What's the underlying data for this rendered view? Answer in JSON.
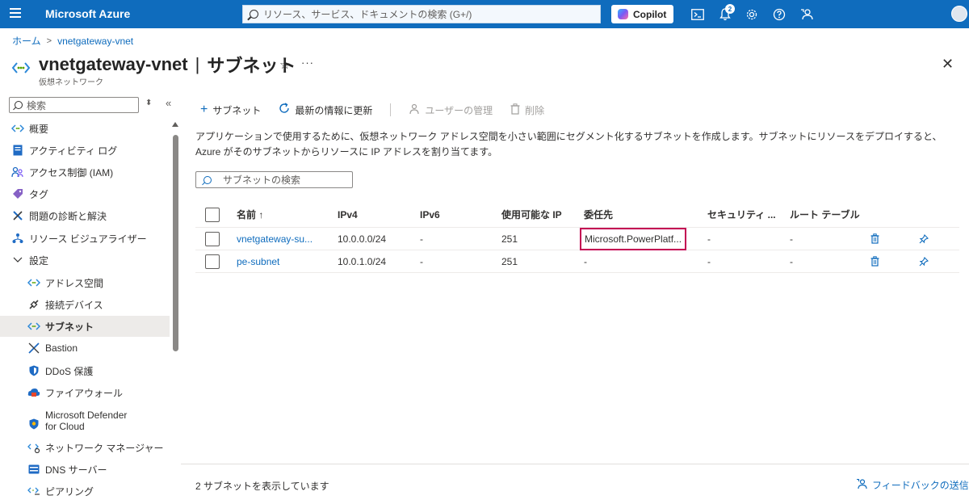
{
  "topbar": {
    "brand": "Microsoft Azure",
    "search_placeholder": "リソース、サービス、ドキュメントの検索 (G+/)",
    "copilot_label": "Copilot",
    "notification_count": "2",
    "accent_color": "#0f6cbd"
  },
  "breadcrumb": {
    "home": "ホーム",
    "current": "vnetgateway-vnet"
  },
  "header": {
    "resource_name": "vnetgateway-vnet",
    "separator": "|",
    "section": "サブネット",
    "subtitle": "仮想ネットワーク"
  },
  "sidebar": {
    "search_placeholder": "検索",
    "items": [
      {
        "label": "概要",
        "icon": "overview-icon"
      },
      {
        "label": "アクティビティ ログ",
        "icon": "activity-log-icon"
      },
      {
        "label": "アクセス制御 (IAM)",
        "icon": "iam-icon"
      },
      {
        "label": "タグ",
        "icon": "tag-icon"
      },
      {
        "label": "問題の診断と解決",
        "icon": "diagnose-icon"
      },
      {
        "label": "リソース ビジュアライザー",
        "icon": "visualizer-icon"
      },
      {
        "label": "設定",
        "icon": "chevron-down-icon"
      },
      {
        "label": "アドレス空間",
        "icon": "address-space-icon"
      },
      {
        "label": "接続デバイス",
        "icon": "connected-devices-icon"
      },
      {
        "label": "サブネット",
        "icon": "subnet-icon"
      },
      {
        "label": "Bastion",
        "icon": "bastion-icon"
      },
      {
        "label": "DDoS 保護",
        "icon": "ddos-icon"
      },
      {
        "label": "ファイアウォール",
        "icon": "firewall-icon"
      },
      {
        "label": "Microsoft Defender for Cloud",
        "line1": "Microsoft Defender",
        "line2": "for Cloud",
        "icon": "defender-icon"
      },
      {
        "label": "ネットワーク マネージャー",
        "icon": "network-manager-icon"
      },
      {
        "label": "DNS サーバー",
        "icon": "dns-icon"
      },
      {
        "label": "ピアリング",
        "icon": "peering-icon"
      }
    ]
  },
  "toolbar": {
    "add_subnet": "サブネット",
    "refresh": "最新の情報に更新",
    "manage_users": "ユーザーの管理",
    "delete": "削除"
  },
  "description": "アプリケーションで使用するために、仮想ネットワーク アドレス空間を小さい範囲にセグメント化するサブネットを作成します。サブネットにリソースをデプロイすると、Azure がそのサブネットからリソースに IP アドレスを割り当てます。",
  "subnet_search_placeholder": "サブネットの検索",
  "table": {
    "columns": [
      "名前 ↑",
      "IPv4",
      "IPv6",
      "使用可能な IP",
      "委任先",
      "セキュリティ ...",
      "ルート テーブル"
    ],
    "rows": [
      {
        "name": "vnetgateway-su...",
        "ipv4": "10.0.0.0/24",
        "ipv6": "-",
        "available_ips": "251",
        "delegation": "Microsoft.PowerPlatf...",
        "security": "-",
        "route_table": "-"
      },
      {
        "name": "pe-subnet",
        "ipv4": "10.0.1.0/24",
        "ipv6": "-",
        "available_ips": "251",
        "delegation": "-",
        "security": "-",
        "route_table": "-"
      }
    ]
  },
  "footer": {
    "count_text": "2 サブネットを表示しています",
    "feedback": "フィードバックの送信"
  }
}
